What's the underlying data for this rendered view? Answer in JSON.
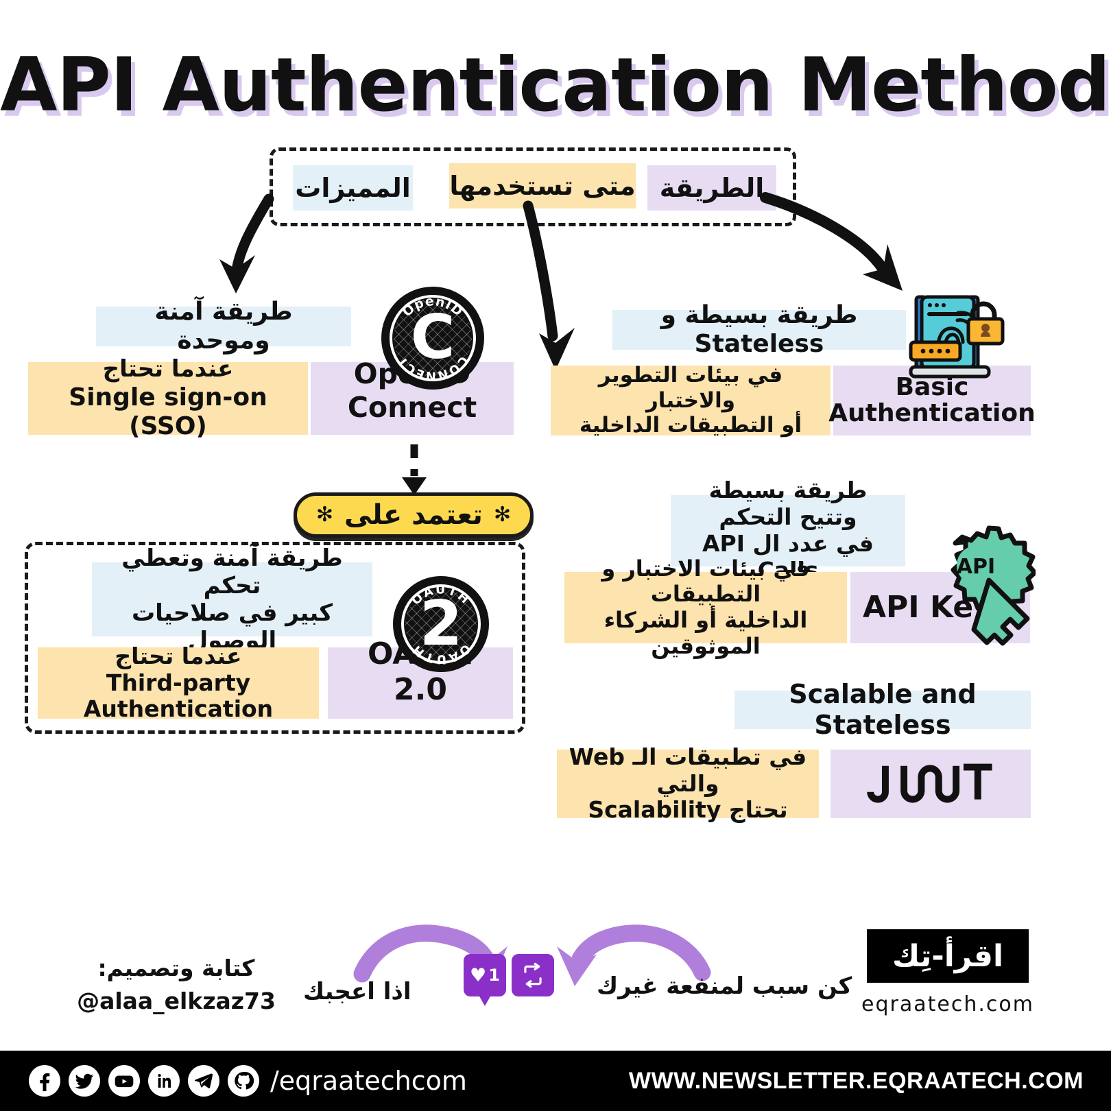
{
  "title": "API Authentication Methods",
  "legend": {
    "items": [
      {
        "label": "المميزات",
        "color": "#e3f0f8",
        "name": "features"
      },
      {
        "label": "متى تستخدمها",
        "color": "#fde3ad",
        "name": "when-to-use"
      },
      {
        "label": "الطريقة",
        "color": "#e8dcf2",
        "name": "method"
      }
    ]
  },
  "methods": {
    "openid": {
      "name": "OpenID Connect",
      "features": "طريقة آمنة وموحدة",
      "when_line1": "عندما تحتاج",
      "when_line2": "Single sign-on (SSO)",
      "badge_top": "OpenID",
      "badge_bottom": "CONNECT",
      "badge_glyph": "C"
    },
    "basic": {
      "name_line1": "Basic",
      "name_line2": "Authentication",
      "features": "طريقة بسيطة و Stateless",
      "when_line1": "في بيئات التطوير والاختبار",
      "when_line2": "أو التطبيقات الداخلية"
    },
    "apikey": {
      "name": "API Key",
      "features_line1": "طريقة بسيطة وتتيح التحكم",
      "features_line2": "في عدد ال API Calls",
      "when_line1": "في بيئات الاختبار و التطبيقات",
      "when_line2": "الداخلية أو الشركاء الموثوقين",
      "icon_label": "API"
    },
    "oauth": {
      "name": "OAuth 2.0",
      "features_line1": "طريقة آمنة وتعطي تحكم",
      "features_line2": "كبير في صلاحيات الوصول",
      "when_line1": "عندما تحتاج",
      "when_line2": "Third-party Authentication",
      "badge_top": "OAUTH",
      "badge_bottom": "OAUTH",
      "badge_glyph": "2"
    },
    "jwt": {
      "name": "JWT",
      "features": "Scalable and Stateless",
      "when_line1": "في تطبيقات الـ Web والتي",
      "when_line2": "تحتاج Scalability"
    }
  },
  "depends_on": {
    "label": "تعتمد على",
    "asterisk": "✻"
  },
  "cta": {
    "left": "اذا اعجبك",
    "right": "كن سبب لمنفعة غيرك",
    "like_count": "1"
  },
  "credits": {
    "line1": "كتابة وتصميم:",
    "line2": "@alaa_elkzaz73"
  },
  "brand": {
    "logo_text": "اقرأ-تِك",
    "url": "eqraatech.com"
  },
  "footer": {
    "handle": "/eqraatechcom",
    "newsletter": "WWW.NEWSLETTER.EQRAATECH.COM",
    "socials": [
      "facebook-icon",
      "twitter-icon",
      "youtube-icon",
      "linkedin-icon",
      "telegram-icon",
      "github-icon"
    ]
  },
  "colors": {
    "features": "#e3f0f8",
    "when": "#fde3ad",
    "method": "#e8dcf2",
    "pill": "#fcd94f",
    "accent_purple": "#8b2fc9",
    "arrow_purple": "#b07fdb",
    "title_shadow": "#d9c9ef"
  }
}
